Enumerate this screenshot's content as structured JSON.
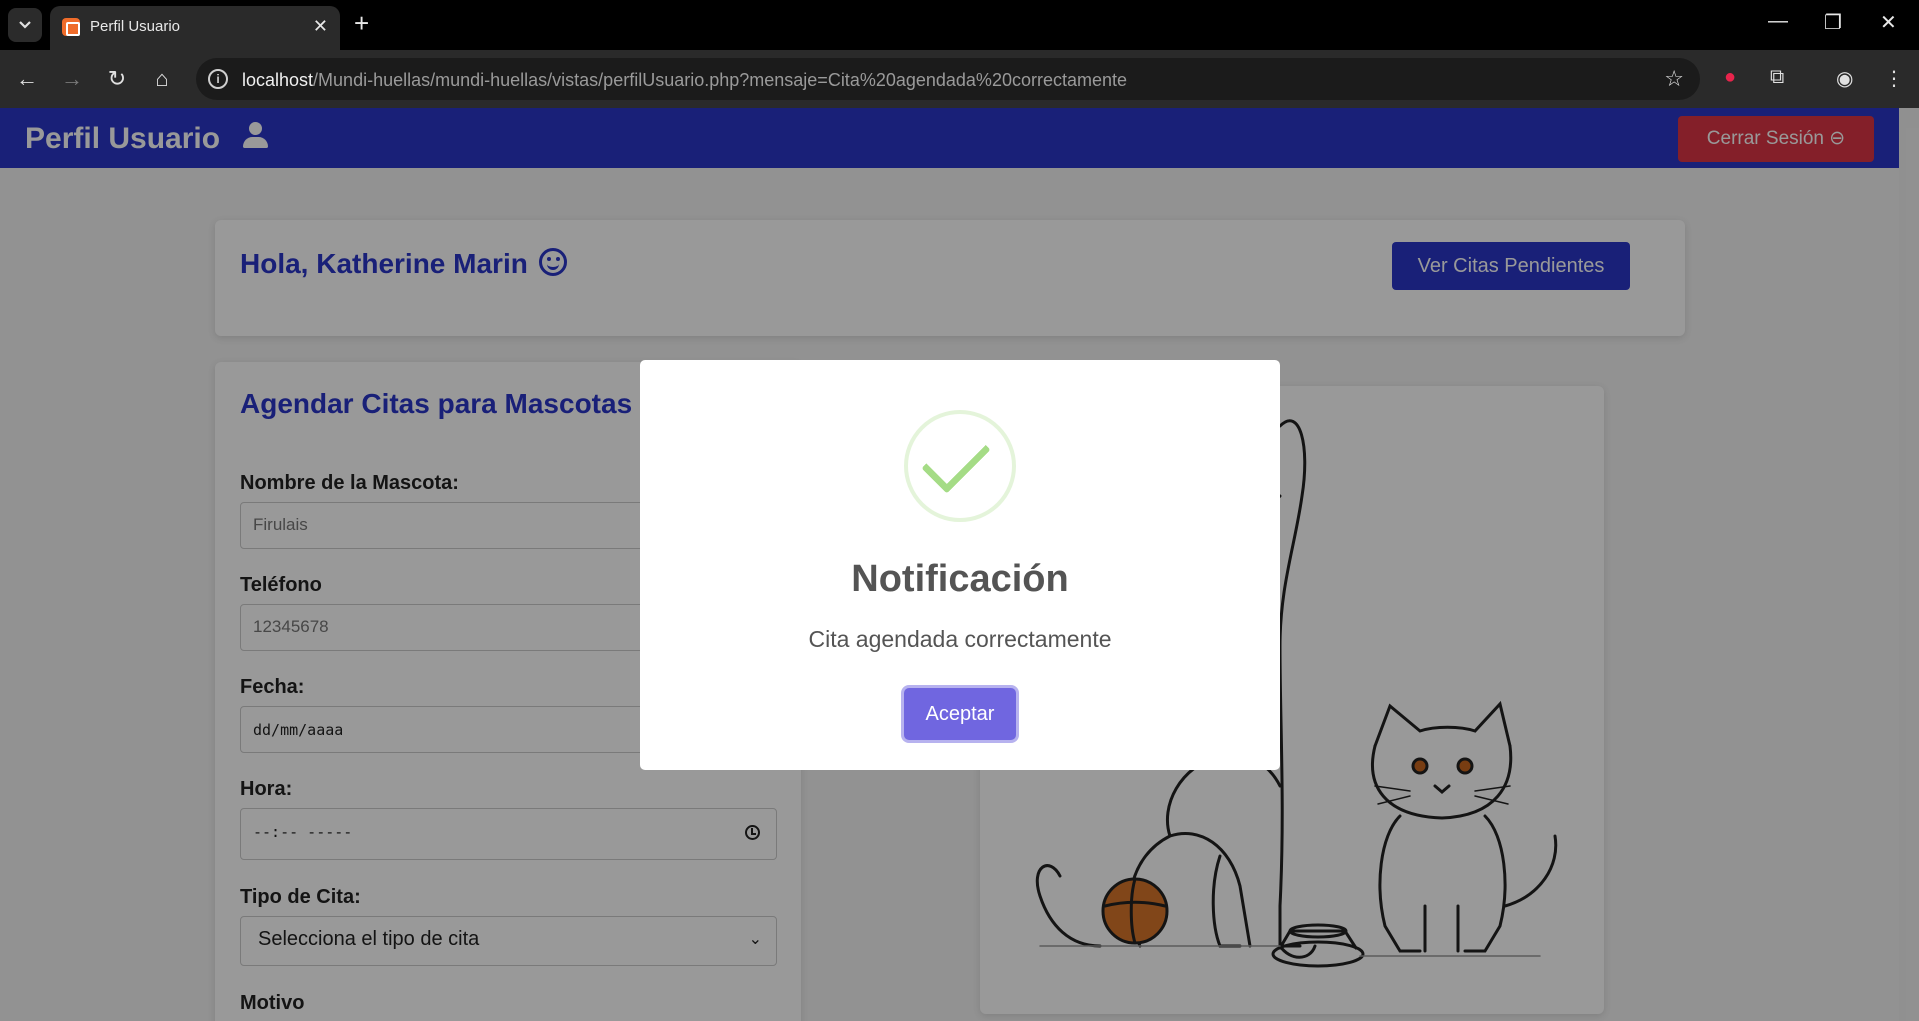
{
  "browser": {
    "tab_title": "Perfil Usuario",
    "url_host": "localhost",
    "url_path": "/Mundi-huellas/mundi-huellas/vistas/perfilUsuario.php?mensaje=Cita%20agendada%20correctamente"
  },
  "navbar": {
    "title": "Perfil Usuario",
    "logout_label": "Cerrar Sesión",
    "logout_icon": "logout-icon",
    "user_icon": "user-icon"
  },
  "greeting": {
    "text": "Hola, Katherine Marin",
    "icon": "smile-icon",
    "pending_button": "Ver Citas Pendientes"
  },
  "form": {
    "title": "Agendar Citas para Mascotas",
    "pet_label": "Nombre de la Mascota:",
    "pet_placeholder": "Firulais",
    "phone_label": "Teléfono",
    "phone_placeholder": "12345678",
    "date_label": "Fecha:",
    "date_placeholder": "dd/mm/aaaa",
    "time_label": "Hora:",
    "time_placeholder": "--:-- -----",
    "type_label": "Tipo de Cita:",
    "type_selected": "Selecciona el tipo de cita",
    "reason_label": "Motivo"
  },
  "modal": {
    "title": "Notificación",
    "message": "Cita agendada correctamente",
    "confirm_label": "Aceptar",
    "icon": "success-check-icon"
  },
  "colors": {
    "primary": "#2b36c9",
    "danger": "#dc3545",
    "confirm": "#7066e0",
    "success": "#a5dc86"
  }
}
